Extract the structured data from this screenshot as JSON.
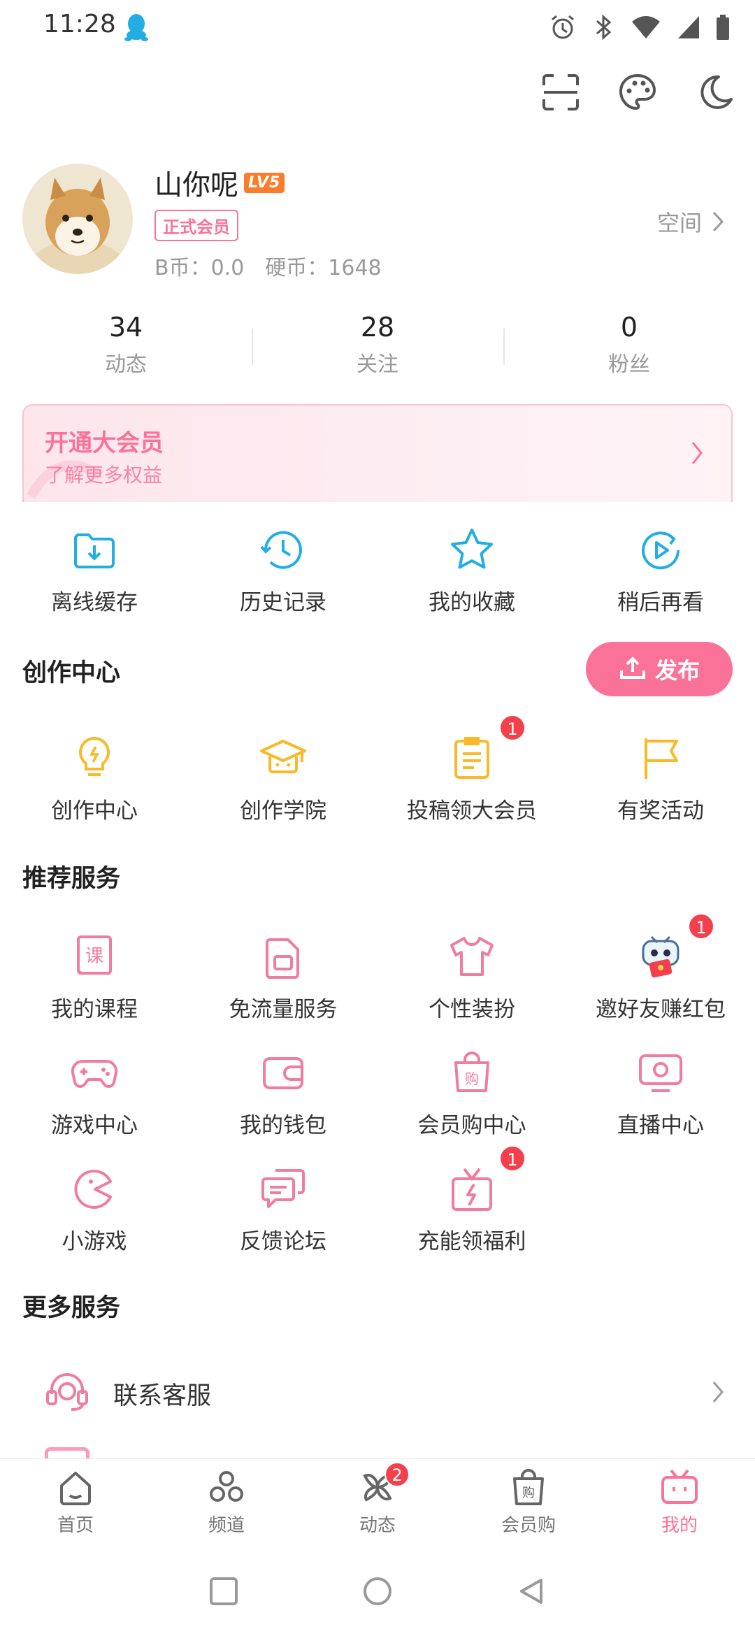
{
  "status_bar": {
    "time": "11:28"
  },
  "profile": {
    "username": "山你呢",
    "level": "LV5",
    "vip_tag": "正式会员",
    "b_coins": "B币：0.0",
    "hard_coins": "硬币：1648",
    "space_label": "空间"
  },
  "stats": [
    {
      "value": "34",
      "label": "动态"
    },
    {
      "value": "28",
      "label": "关注"
    },
    {
      "value": "0",
      "label": "粉丝"
    }
  ],
  "vip_banner": {
    "title": "开通大会员",
    "subtitle": "了解更多权益"
  },
  "quick_actions": [
    {
      "label": "离线缓存",
      "icon": "download-folder-icon"
    },
    {
      "label": "历史记录",
      "icon": "history-clock-icon"
    },
    {
      "label": "我的收藏",
      "icon": "star-icon"
    },
    {
      "label": "稍后再看",
      "icon": "watch-later-icon"
    }
  ],
  "creation": {
    "title": "创作中心",
    "publish_label": "发布",
    "items": [
      {
        "label": "创作中心",
        "icon": "lightbulb-icon"
      },
      {
        "label": "创作学院",
        "icon": "graduation-cap-icon"
      },
      {
        "label": "投稿领大会员",
        "icon": "clipboard-icon",
        "badge": "1"
      },
      {
        "label": "有奖活动",
        "icon": "flag-icon"
      }
    ]
  },
  "recommended": {
    "title": "推荐服务",
    "items": [
      {
        "label": "我的课程",
        "icon": "course-book-icon"
      },
      {
        "label": "免流量服务",
        "icon": "sim-card-icon"
      },
      {
        "label": "个性装扮",
        "icon": "tshirt-icon"
      },
      {
        "label": "邀好友赚红包",
        "icon": "mascot-red-envelope-icon",
        "badge": "1"
      },
      {
        "label": "游戏中心",
        "icon": "gamepad-icon"
      },
      {
        "label": "我的钱包",
        "icon": "wallet-icon"
      },
      {
        "label": "会员购中心",
        "icon": "shopping-bag-icon"
      },
      {
        "label": "直播中心",
        "icon": "live-tv-icon"
      },
      {
        "label": "小游戏",
        "icon": "pacman-icon"
      },
      {
        "label": "反馈论坛",
        "icon": "chat-bubbles-icon"
      },
      {
        "label": "充能领福利",
        "icon": "gift-bolt-icon",
        "badge": "1"
      }
    ]
  },
  "more_services": {
    "title": "更多服务",
    "items": [
      {
        "label": "联系客服",
        "icon": "headset-icon"
      }
    ]
  },
  "tabbar": [
    {
      "label": "首页",
      "icon": "home-icon"
    },
    {
      "label": "频道",
      "icon": "channel-icon"
    },
    {
      "label": "动态",
      "icon": "pinwheel-icon",
      "badge": "2"
    },
    {
      "label": "会员购",
      "icon": "shopping-bag-icon"
    },
    {
      "label": "我的",
      "icon": "bilibili-tv-icon",
      "active": true
    }
  ],
  "colors": {
    "accent": "#fb7299",
    "blue_icon": "#23ade5",
    "gold_icon": "#f9b928",
    "badge": "#f3404b"
  }
}
